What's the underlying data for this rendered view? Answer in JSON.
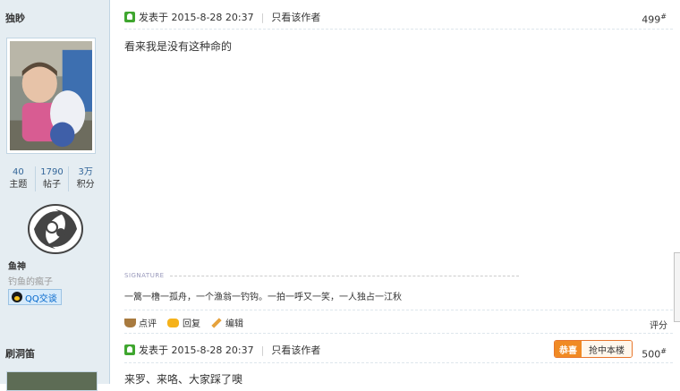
{
  "post1": {
    "author": "独眇",
    "stats": [
      {
        "value": "40",
        "label": "主题"
      },
      {
        "value": "1790",
        "label": "帖子"
      },
      {
        "value": "3万",
        "label": "积分"
      }
    ],
    "rank": "鱼神",
    "rank_desc": "钓鱼的瘋子",
    "qq_label": "QQ交谈",
    "posted_at": "发表于 2015-8-28 20:37",
    "only_author": "只看该作者",
    "floor": "499",
    "floor_sup": "#",
    "content": "看来我是没有这种命的",
    "signature_label": "SIGNATURE",
    "signature": "一篙一橹一孤舟，一个渔翁一钓钩。一拍一呼又一笑，一人独占一江秋",
    "actions": {
      "comment": "点评",
      "reply": "回复",
      "edit": "编辑"
    },
    "rate": "评分"
  },
  "post2": {
    "author": "刷洞笛",
    "posted_at": "发表于 2015-8-28 20:37",
    "only_author": "只看该作者",
    "floor": "500",
    "floor_sup": "#",
    "badge_left": "恭喜",
    "badge_right": "抢中本楼",
    "content": "来罗、来咯、大家踩了噢"
  }
}
